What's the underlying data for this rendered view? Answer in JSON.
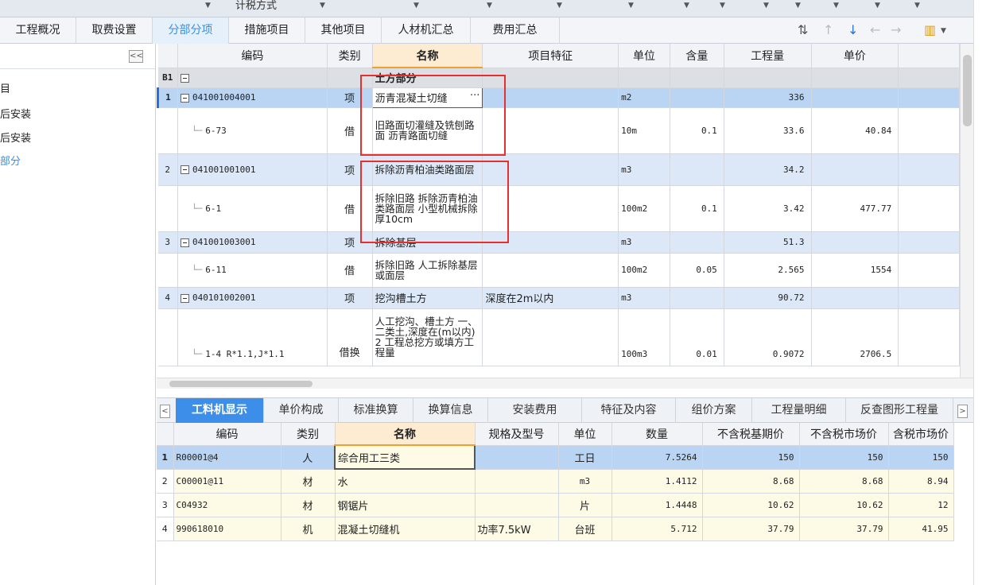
{
  "top_strip": {
    "caption": "计税方式"
  },
  "main_tabs": [
    {
      "label": "工程概况"
    },
    {
      "label": "取费设置"
    },
    {
      "label": "分部分项"
    },
    {
      "label": "措施项目"
    },
    {
      "label": "其他项目"
    },
    {
      "label": "人材机汇总"
    },
    {
      "label": "费用汇总"
    }
  ],
  "toolbar_icons": [
    "sort-icon",
    "move-top-icon",
    "move-down-icon",
    "move-left-icon",
    "move-right-icon",
    "format-icon"
  ],
  "sidebar": {
    "collapse_glyph": "<<",
    "items": [
      {
        "label": "目"
      },
      {
        "label": "后安装"
      },
      {
        "label": "后安装"
      },
      {
        "label": "部分"
      }
    ]
  },
  "grid_top": {
    "columns": [
      "编码",
      "类别",
      "名称",
      "项目特征",
      "单位",
      "含量",
      "工程量",
      "单价"
    ],
    "section": {
      "no": "B1",
      "name": "土方部分"
    },
    "rows": [
      {
        "no": "1",
        "code": "041001004001",
        "type": "项",
        "name": "沥青混凝土切缝",
        "feature": "",
        "unit": "m2",
        "content": "",
        "qty": "336",
        "price": ""
      },
      {
        "no": "",
        "code": "6-73",
        "type": "借",
        "name": "旧路面切灌缝及铣刨路面 沥青路面切缝",
        "feature": "",
        "unit": "10m",
        "content": "0.1",
        "qty": "33.6",
        "price": "40.84"
      },
      {
        "no": "2",
        "code": "041001001001",
        "type": "项",
        "name": "拆除沥青柏油类路面层",
        "feature": "",
        "unit": "m3",
        "content": "",
        "qty": "34.2",
        "price": ""
      },
      {
        "no": "",
        "code": "6-1",
        "type": "借",
        "name": "拆除旧路 拆除沥青柏油类路面层 小型机械拆除 厚10cm",
        "feature": "",
        "unit": "100m2",
        "content": "0.1",
        "qty": "3.42",
        "price": "477.77"
      },
      {
        "no": "3",
        "code": "041001003001",
        "type": "项",
        "name": "拆除基层",
        "feature": "",
        "unit": "m3",
        "content": "",
        "qty": "51.3",
        "price": ""
      },
      {
        "no": "",
        "code": "6-11",
        "type": "借",
        "name": "拆除旧路 人工拆除基层或面层",
        "feature": "",
        "unit": "100m2",
        "content": "0.05",
        "qty": "2.565",
        "price": "1554"
      },
      {
        "no": "4",
        "code": "040101002001",
        "type": "项",
        "name": "挖沟槽土方",
        "feature": "深度在2m以内",
        "unit": "m3",
        "content": "",
        "qty": "90.72",
        "price": ""
      },
      {
        "no": "",
        "code": "1-4 R*1.1,J*1.1",
        "type": "借换",
        "name": "人工挖沟、槽土方 一、二类土,深度在(m以内) 2 工程总挖方或填方工程量",
        "feature": "",
        "unit": "100m3",
        "content": "0.01",
        "qty": "0.9072",
        "price": "2706.5"
      }
    ]
  },
  "bottom_tabs": [
    {
      "label": "工料机显示"
    },
    {
      "label": "单价构成"
    },
    {
      "label": "标准换算"
    },
    {
      "label": "换算信息"
    },
    {
      "label": "安装费用"
    },
    {
      "label": "特征及内容"
    },
    {
      "label": "组价方案"
    },
    {
      "label": "工程量明细"
    },
    {
      "label": "反查图形工程量"
    }
  ],
  "grid_bottom": {
    "columns": [
      "编码",
      "类别",
      "名称",
      "规格及型号",
      "单位",
      "数量",
      "不含税基期价",
      "不含税市场价",
      "含税市场价"
    ],
    "rows": [
      {
        "no": "1",
        "code": "R00001@4",
        "type": "人",
        "name": "综合用工三类",
        "spec": "",
        "unit": "工日",
        "qty": "7.5264",
        "base": "150",
        "market": "150",
        "tax": "150"
      },
      {
        "no": "2",
        "code": "C00001@11",
        "type": "材",
        "name": "水",
        "spec": "",
        "unit": "m3",
        "qty": "1.4112",
        "base": "8.68",
        "market": "8.68",
        "tax": "8.94"
      },
      {
        "no": "3",
        "code": "C04932",
        "type": "材",
        "name": "钢锯片",
        "spec": "",
        "unit": "片",
        "qty": "1.4448",
        "base": "10.62",
        "market": "10.62",
        "tax": "12"
      },
      {
        "no": "4",
        "code": "990618010",
        "type": "机",
        "name": "混凝土切缝机",
        "spec": "功率7.5kW",
        "unit": "台班",
        "qty": "5.712",
        "base": "37.79",
        "market": "37.79",
        "tax": "41.95"
      }
    ]
  }
}
